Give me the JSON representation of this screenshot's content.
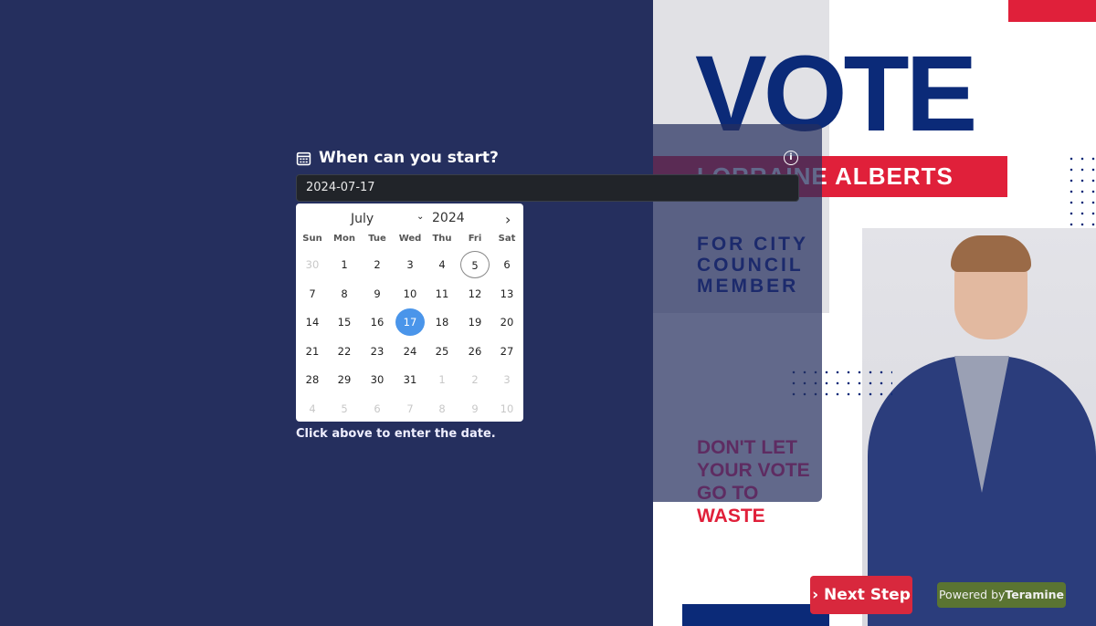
{
  "poster": {
    "headline": "VOTE",
    "candidate": "LORRAINE ALBERTS",
    "subtitle": "FOR CITY\nCOUNCIL\nMEMBER",
    "slogan": "DON'T LET YOUR VOTE GO TO",
    "slogan_emph": "WASTE"
  },
  "field": {
    "label": "When can you start?",
    "value": "2024-07-17",
    "hint": "Click above to enter the date.",
    "icon": "calendar-icon",
    "info_icon": "info-icon"
  },
  "calendar": {
    "month": "July",
    "year": "2024",
    "weekdays": [
      "Sun",
      "Mon",
      "Tue",
      "Wed",
      "Thu",
      "Fri",
      "Sat"
    ],
    "weeks": [
      [
        "30",
        "1",
        "2",
        "3",
        "4",
        "5",
        "6"
      ],
      [
        "7",
        "8",
        "9",
        "10",
        "11",
        "12",
        "13"
      ],
      [
        "14",
        "15",
        "16",
        "17",
        "18",
        "19",
        "20"
      ],
      [
        "21",
        "22",
        "23",
        "24",
        "25",
        "26",
        "27"
      ],
      [
        "28",
        "29",
        "30",
        "31",
        "1",
        "2",
        "3"
      ],
      [
        "4",
        "5",
        "6",
        "7",
        "8",
        "9",
        "10"
      ]
    ],
    "selected": "17",
    "today": "5"
  },
  "buttons": {
    "next": "Next Step",
    "next_icon": "chevron-right-icon"
  },
  "footer": {
    "powered": "Powered by",
    "brand": "Teramine"
  },
  "colors": {
    "background": "#252f5e",
    "accent": "#d8283d",
    "selected": "#4a95ea",
    "badge": "#5a7432"
  }
}
